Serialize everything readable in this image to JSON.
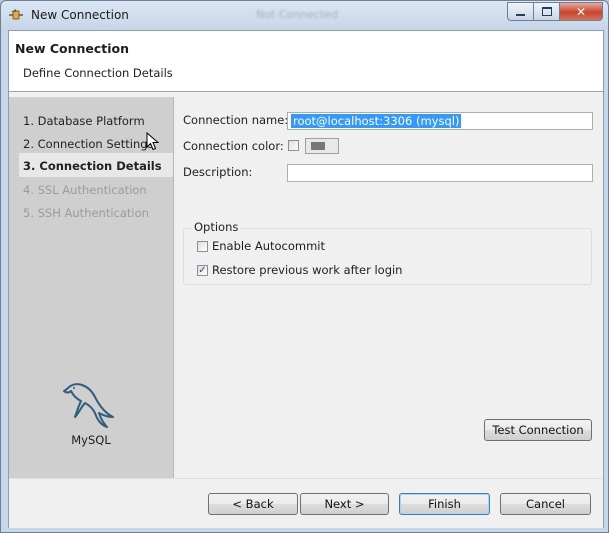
{
  "window": {
    "title": "New Connection",
    "background_title": "Not Connected"
  },
  "header": {
    "title": "New Connection",
    "subtitle": "Define Connection Details"
  },
  "steps": [
    {
      "label": "1. Database Platform",
      "state": "done"
    },
    {
      "label": "2. Connection Settings",
      "state": "done"
    },
    {
      "label": "3. Connection Details",
      "state": "current"
    },
    {
      "label": "4. SSL Authentication",
      "state": "disabled"
    },
    {
      "label": "5. SSH Authentication",
      "state": "disabled"
    }
  ],
  "platform": {
    "name": "MySQL",
    "icon": "dolphin-icon"
  },
  "form": {
    "connection_name_label": "Connection name:",
    "connection_name_value": "root@localhost:3306 (mysql)",
    "connection_color_label": "Connection color:",
    "connection_color_checked": false,
    "connection_color_value": "#777777",
    "description_label": "Description:",
    "description_value": "",
    "options_label": "Options",
    "enable_autocommit_label": "Enable Autocommit",
    "enable_autocommit_checked": false,
    "restore_work_label": "Restore previous work after login",
    "restore_work_checked": true
  },
  "buttons": {
    "test_connection": "Test Connection",
    "back": "< Back",
    "next": "Next >",
    "finish": "Finish",
    "cancel": "Cancel"
  },
  "colors": {
    "selection": "#3399ff",
    "step_panel": "#cfcfcf",
    "dolphin": "#2f5f7d"
  }
}
